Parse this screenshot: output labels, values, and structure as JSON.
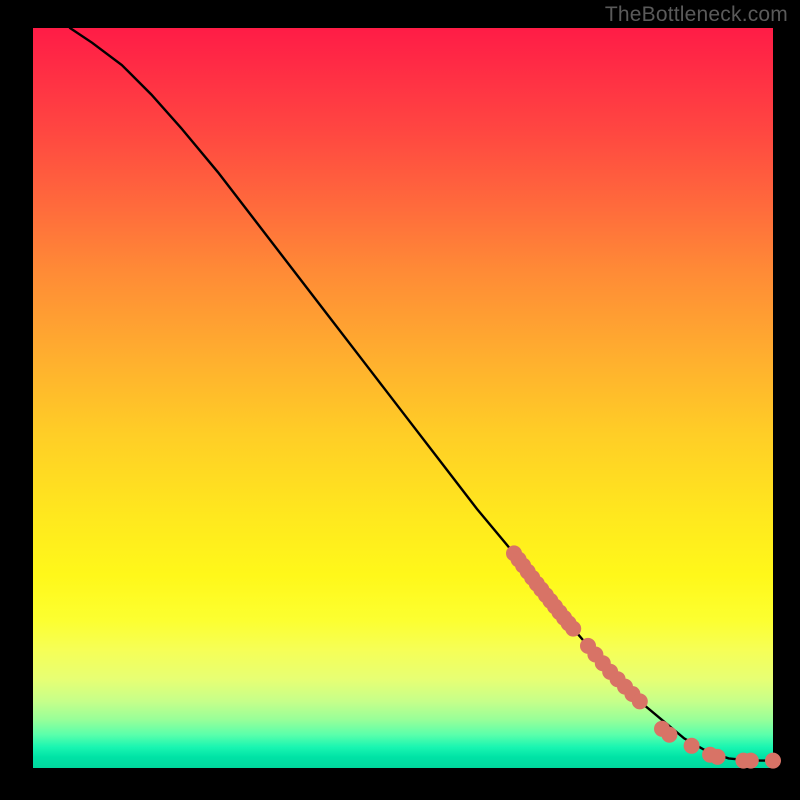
{
  "watermark": "TheBottleneck.com",
  "chart_data": {
    "type": "line",
    "title": "",
    "xlabel": "",
    "ylabel": "",
    "xlim": [
      0,
      100
    ],
    "ylim": [
      0,
      100
    ],
    "grid": false,
    "legend": false,
    "series": [
      {
        "name": "curve",
        "x": [
          5,
          8,
          12,
          16,
          20,
          25,
          30,
          35,
          40,
          45,
          50,
          55,
          60,
          65,
          68,
          72,
          75,
          78,
          80,
          82,
          85,
          88,
          91,
          94,
          97,
          100
        ],
        "y": [
          100,
          98,
          95,
          91,
          86.5,
          80.5,
          74,
          67.5,
          61,
          54.5,
          48,
          41.5,
          35,
          29,
          25,
          20,
          16.5,
          13,
          11,
          9,
          6.5,
          4,
          2.3,
          1.3,
          1,
          1
        ]
      }
    ],
    "markers": [
      {
        "name": "upper-cluster",
        "x_range": [
          65,
          73
        ],
        "y_range": [
          19,
          30
        ],
        "count_approx": 14
      },
      {
        "name": "mid-cluster",
        "x_range": [
          75,
          82
        ],
        "y_range": [
          8,
          16
        ],
        "count_approx": 8
      },
      {
        "name": "tail-points",
        "points": [
          [
            85,
            5.3
          ],
          [
            86,
            4.5
          ],
          [
            89,
            3.0
          ],
          [
            91.5,
            1.8
          ],
          [
            92.5,
            1.5
          ],
          [
            96,
            1.0
          ],
          [
            97,
            1.0
          ],
          [
            100,
            1.0
          ]
        ]
      }
    ],
    "marker_style": {
      "color": "#d87366",
      "radius_px": 8
    }
  }
}
